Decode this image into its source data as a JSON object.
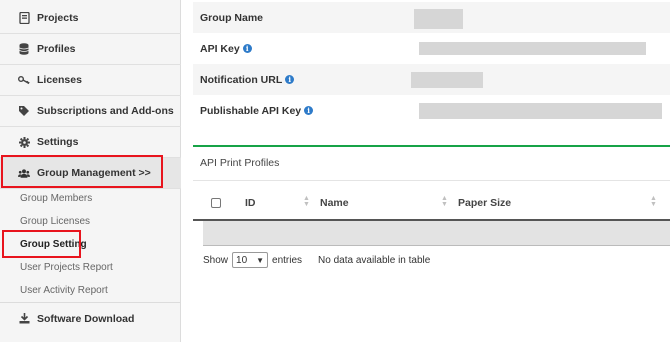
{
  "sidebar": {
    "items": [
      {
        "label": "Projects",
        "icon": "document-icon"
      },
      {
        "label": "Profiles",
        "icon": "database-icon"
      },
      {
        "label": "Licenses",
        "icon": "key-icon"
      },
      {
        "label": "Subscriptions and Add-ons",
        "icon": "tag-icon"
      },
      {
        "label": "Settings",
        "icon": "gear-icon"
      },
      {
        "label": "Group Management >>",
        "icon": "users-icon"
      }
    ],
    "sub_items": [
      {
        "label": "Group Members"
      },
      {
        "label": "Group Licenses"
      },
      {
        "label": "Group Setting"
      },
      {
        "label": "User Projects Report"
      },
      {
        "label": "User Activity Report"
      }
    ],
    "bottom_item": {
      "label": "Software Download",
      "icon": "download-icon"
    }
  },
  "settings": {
    "fields": [
      {
        "label": "Group Name",
        "info": false
      },
      {
        "label": "API Key",
        "info": true
      },
      {
        "label": "Notification URL",
        "info": true
      },
      {
        "label": "Publishable API Key",
        "info": true
      }
    ]
  },
  "panel": {
    "title": "API Print Profiles",
    "columns": [
      "ID",
      "Name",
      "Paper Size"
    ],
    "show_label": "Show",
    "entries_value": "10",
    "entries_label": "entries",
    "empty_text": "No data available in table"
  },
  "colors": {
    "highlight": "#e8141d",
    "panel_accent": "#17a347",
    "info_icon": "#2e7bc9"
  }
}
